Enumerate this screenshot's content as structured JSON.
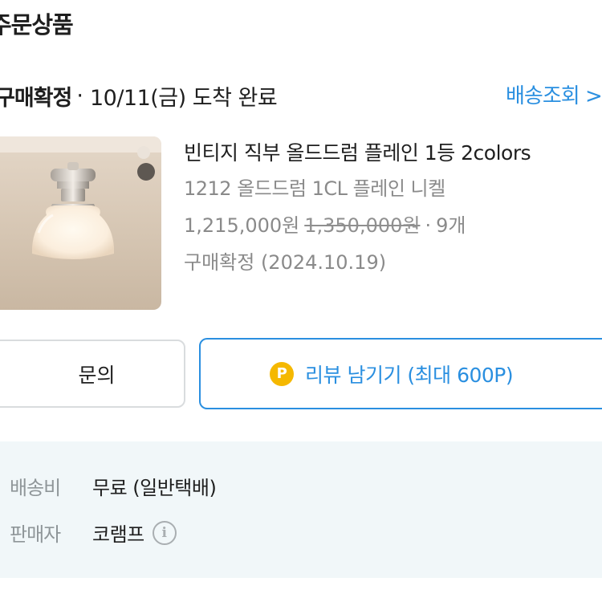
{
  "section": {
    "title": "주문상품"
  },
  "order": {
    "status": "구매확정",
    "separator": "·",
    "arrival": "10/11(금) 도착 완료",
    "track_label": "배송조회 >"
  },
  "product": {
    "name": "빈티지 직부 올드드럼 플레인 1등 2colors",
    "option": "1212 올드드럼 1CL 플레인 니켈",
    "price": "1,215,000원",
    "original_price": "1,350,000원",
    "quantity_separator": "·",
    "quantity": "9개",
    "confirmation": "구매확정 (2024.10.19)"
  },
  "actions": {
    "inquiry_label": "문의",
    "review_badge": "P",
    "review_label": "리뷰 남기기 (최대 600P)"
  },
  "delivery_info": {
    "shipping_label": "배송비",
    "shipping_value": "무료 (일반택배)",
    "seller_label": "판매자",
    "seller_value": "코램프",
    "info_icon_glyph": "i"
  },
  "colors": {
    "accent": "#2a8fe0",
    "point": "#f5b800",
    "info_bg": "#f1f7f9"
  },
  "icons": {
    "seller_info": "info-icon",
    "review_point": "point-coin-icon"
  }
}
